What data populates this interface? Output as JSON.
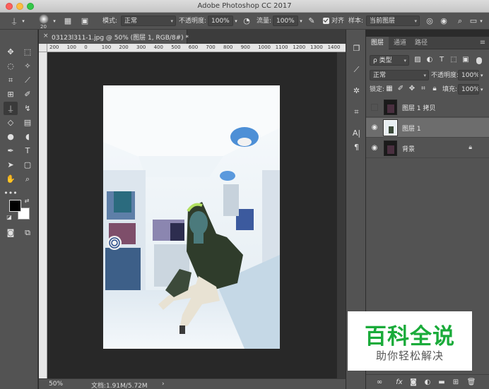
{
  "window": {
    "title": "Adobe Photoshop CC 2017"
  },
  "options_bar": {
    "brush_size": "20",
    "mode_label": "模式:",
    "mode_value": "正常",
    "opacity_label": "不透明度:",
    "opacity_value": "100%",
    "flow_label": "流量:",
    "flow_value": "100%",
    "align_label": "对齐",
    "sample_label": "样本:",
    "sample_value": "当前图层"
  },
  "document": {
    "tab_label": "03123l311-1.jpg @ 50% (图层 1, RGB/8#) *",
    "ruler_labels": [
      "200",
      "100",
      "0",
      "100",
      "200",
      "300",
      "400",
      "500",
      "600",
      "700",
      "800",
      "900",
      "1000",
      "1100",
      "1200",
      "1300",
      "1400"
    ],
    "zoom": "50%",
    "doc_info": "文档:1.91M/5.72M",
    "status_arrow": "›"
  },
  "layers_panel": {
    "tabs": [
      "图层",
      "通道",
      "路径"
    ],
    "filter_value": "ρ 类型",
    "blend_mode": "正常",
    "opacity_label": "不透明度:",
    "opacity_value": "100%",
    "lock_label": "锁定:",
    "fill_label": "填充:",
    "fill_value": "100%",
    "layers": [
      {
        "name": "图层 1 拷贝",
        "visible": false,
        "selected": false
      },
      {
        "name": "图层 1",
        "visible": true,
        "selected": true
      },
      {
        "name": "背景",
        "visible": true,
        "selected": false,
        "locked": true
      }
    ],
    "bottom_fx": "fx"
  },
  "watermark": {
    "title": "百科全说",
    "subtitle": "助你轻松解决"
  },
  "colors": {
    "accent_green": "#1aab3a",
    "panel_bg": "#535353",
    "canvas_bg": "#282828"
  }
}
